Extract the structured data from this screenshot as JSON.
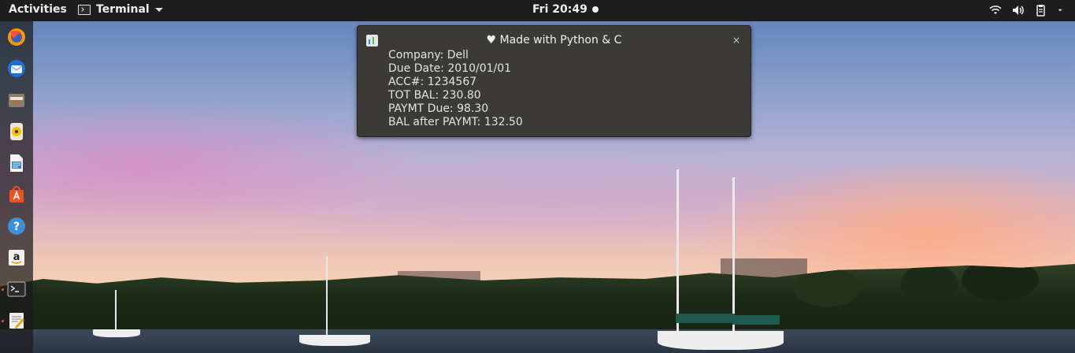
{
  "topbar": {
    "activities_label": "Activities",
    "app_menu_label": "Terminal",
    "clock": "Fri 20:49"
  },
  "tray": {
    "icons": [
      "wifi-icon",
      "volume-icon",
      "clipboard-icon"
    ]
  },
  "dock": {
    "items": [
      "firefox",
      "thunderbird",
      "files",
      "rhythmbox",
      "libreoffice-writer",
      "ubuntu-software",
      "help",
      "amazon",
      "terminal",
      "text-editor"
    ]
  },
  "notification": {
    "title": "♥ Made with Python & C",
    "close_label": "×",
    "lines": [
      "Company: Dell",
      "Due Date: 2010/01/01",
      "ACC#: 1234567",
      "TOT BAL: 230.80",
      "PAYMT Due: 98.30",
      "BAL after PAYMT: 132.50"
    ]
  },
  "colors": {
    "topbar": "#1d1d1d",
    "notification_bg": "#3b3a36",
    "accent": "#e95420"
  }
}
